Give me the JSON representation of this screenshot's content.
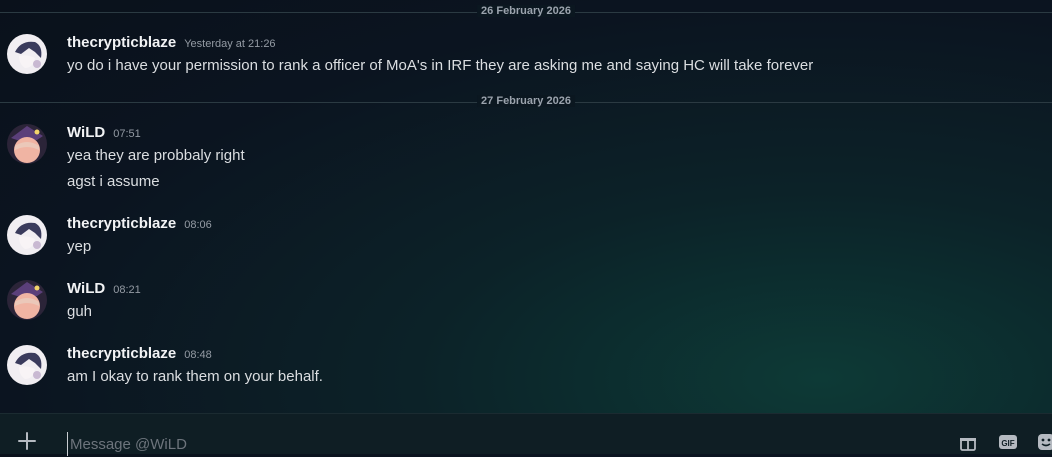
{
  "dividers": [
    "26 February 2026",
    "27 February 2026"
  ],
  "messages": [
    {
      "author": "thecrypticblaze",
      "time": "Yesterday at 21:26",
      "lines": [
        "yo do i have your permission to rank a officer of MoA's in IRF they are asking me and saying HC will take forever"
      ]
    },
    {
      "author": "WiLD",
      "time": "07:51",
      "lines": [
        "yea they are probbaly right",
        "agst i assume"
      ]
    },
    {
      "author": "thecrypticblaze",
      "time": "08:06",
      "lines": [
        "yep"
      ]
    },
    {
      "author": "WiLD",
      "time": "08:21",
      "lines": [
        "guh"
      ]
    },
    {
      "author": "thecrypticblaze",
      "time": "08:48",
      "lines": [
        "am I okay to rank them on your behalf."
      ]
    }
  ],
  "composer": {
    "placeholder": "Message @WiLD"
  },
  "icons": [
    "plus-icon",
    "gift-icon",
    "gif-icon",
    "sticker-icon"
  ]
}
